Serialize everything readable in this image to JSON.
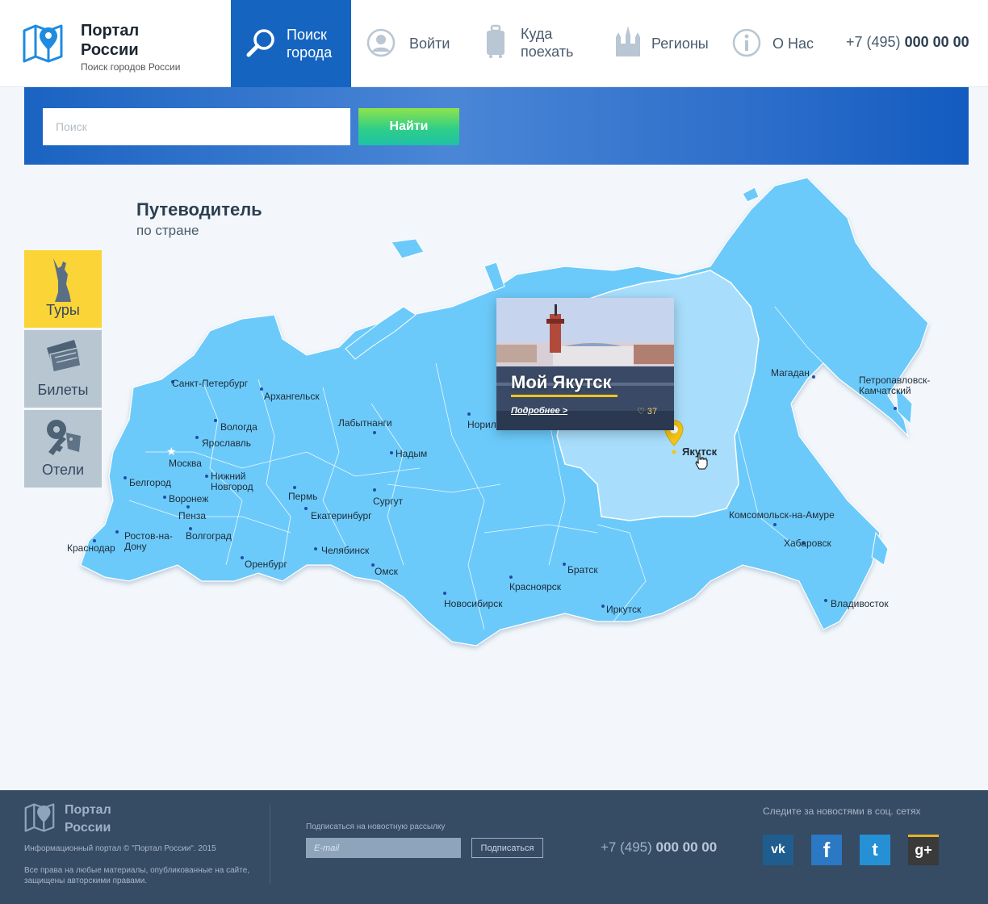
{
  "header": {
    "logo_title": "Портал России",
    "logo_subtitle": "Поиск городов России",
    "nav": [
      {
        "label": "Поиск города",
        "icon": "search-icon",
        "active": true
      },
      {
        "label": "Войти",
        "icon": "user-icon"
      },
      {
        "label": "Куда поехать",
        "icon": "suitcase-icon"
      },
      {
        "label": "Регионы",
        "icon": "kremlin-icon"
      },
      {
        "label": "О Нас",
        "icon": "info-icon"
      }
    ],
    "phone_prefix": "+7 (495)",
    "phone_number": "000 00 00"
  },
  "search": {
    "placeholder": "Поиск",
    "button_label": "Найти"
  },
  "guide": {
    "title": "Путеводитель",
    "subtitle": "по стране"
  },
  "side_menu": [
    {
      "label": "Туры",
      "icon": "monument-icon",
      "active": true
    },
    {
      "label": "Билеты",
      "icon": "tickets-icon"
    },
    {
      "label": "Отели",
      "icon": "key-icon"
    }
  ],
  "map": {
    "cities": [
      "Санкт-Петербург",
      "Архангельск",
      "Вологда",
      "Ярославль",
      "Москва",
      "Нижний Новгород",
      "Белгород",
      "Воронеж",
      "Пенза",
      "Волгоград",
      "Краснодар",
      "Ростов-на-Дону",
      "Пермь",
      "Екатеринбург",
      "Оренбург",
      "Челябинск",
      "Лабытнанги",
      "Надым",
      "Сургут",
      "Омск",
      "Норильск",
      "Новосибирск",
      "Красноярск",
      "Братск",
      "Иркутск",
      "Якутск",
      "Магадан",
      "Петропавловск-Камчатский",
      "Комсомольск-на-Амуре",
      "Хабаровск",
      "Владивосток"
    ],
    "highlighted_region": "Якутск",
    "colors": {
      "land": "#6ccafa",
      "highlight": "#a8defc",
      "dot": "#1f4fa5",
      "pin": "#f5c518"
    }
  },
  "card": {
    "title": "Мой Якутск",
    "more_label": "Подробнее >",
    "likes": "♡ 37"
  },
  "footer": {
    "logo_title": "Портал России",
    "copyright": "Информационный портал © \"Портал России\". 2015",
    "rights": "Все права на любые материалы, опубликованные на сайте, защищены авторскими правами.",
    "newsletter_label": "Подписаться на новостную рассылку",
    "email_placeholder": "E-mail",
    "subscribe_label": "Подписаться",
    "phone_prefix": "+7 (495)",
    "phone_number": "000 00 00",
    "social_label": "Следите за новостями в соц. сетях",
    "social": [
      {
        "label": "vk",
        "icon": "vk-icon",
        "color": "#1f5d8f"
      },
      {
        "label": "f",
        "icon": "facebook-icon",
        "color": "#2b78c5"
      },
      {
        "label": "t",
        "icon": "twitter-icon",
        "color": "#2590d4"
      },
      {
        "label": "g+",
        "icon": "google-plus-icon",
        "color": "#3a3a3a"
      }
    ]
  }
}
